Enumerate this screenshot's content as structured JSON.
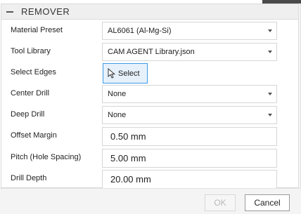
{
  "panel": {
    "title": "REMOVER"
  },
  "fields": {
    "material_preset": {
      "label": "Material Preset",
      "value": "AL6061 (Al-Mg-Si)"
    },
    "tool_library": {
      "label": "Tool Library",
      "value": "CAM AGENT Library.json"
    },
    "select_edges": {
      "label": "Select Edges",
      "button_label": "Select"
    },
    "center_drill": {
      "label": "Center Drill",
      "value": "None"
    },
    "deep_drill": {
      "label": "Deep Drill",
      "value": "None"
    },
    "offset_margin": {
      "label": "Offset Margin",
      "value": "0.50 mm"
    },
    "pitch": {
      "label": "Pitch (Hole Spacing)",
      "value": "5.00 mm"
    },
    "drill_depth": {
      "label": "Drill Depth",
      "value": "20.00 mm"
    }
  },
  "footer": {
    "ok_label": "OK",
    "cancel_label": "Cancel"
  },
  "colors": {
    "accent": "#3c9be8",
    "header_bg": "#efefef"
  }
}
